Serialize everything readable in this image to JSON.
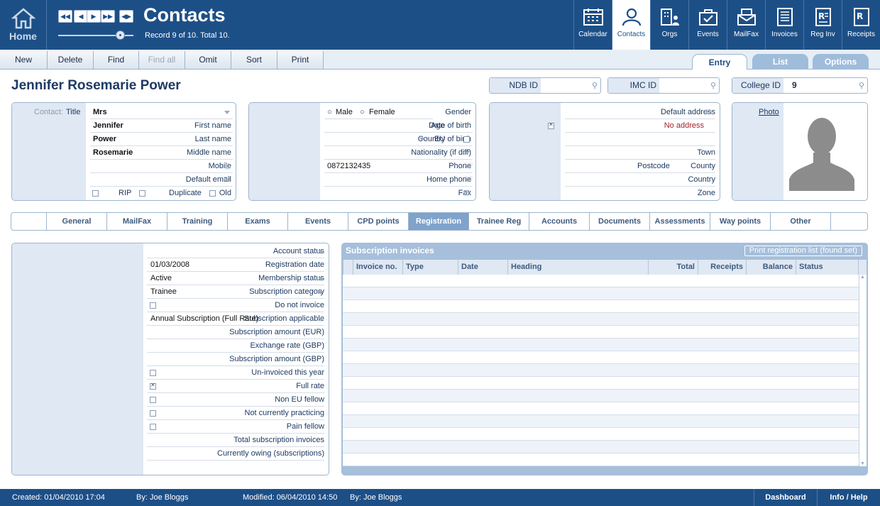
{
  "header": {
    "home_label": "Home",
    "title": "Contacts",
    "record_info": "Record 9 of 10. Total 10.",
    "modules": [
      {
        "label": "Calendar",
        "icon": "calendar-icon"
      },
      {
        "label": "Contacts",
        "icon": "person-icon"
      },
      {
        "label": "Orgs",
        "icon": "org-icon"
      },
      {
        "label": "Events",
        "icon": "events-icon"
      },
      {
        "label": "MailFax",
        "icon": "mail-icon"
      },
      {
        "label": "Invoices",
        "icon": "invoice-icon"
      },
      {
        "label": "Reg Inv",
        "icon": "reginv-icon"
      },
      {
        "label": "Receipts",
        "icon": "receipt-icon"
      }
    ]
  },
  "toolbar": {
    "buttons": [
      "New",
      "Delete",
      "Find",
      "Find all",
      "Omit",
      "Sort",
      "Print"
    ]
  },
  "view_tabs": [
    "Entry",
    "List",
    "Options"
  ],
  "person": {
    "full_name": "Jennifer Rosemarie Power"
  },
  "ids": {
    "ndb_label": "NDB ID",
    "ndb_value": "",
    "imc_label": "IMC ID",
    "imc_value": "",
    "college_label": "College ID",
    "college_value": "9"
  },
  "contact": {
    "contact_label": "Contact:",
    "title_label": "Title",
    "title": "Mrs",
    "first_name_label": "First name",
    "first_name": "Jennifer",
    "last_name_label": "Last name",
    "last_name": "Power",
    "middle_name_label": "Middle name",
    "middle_name": "Rosemarie",
    "mobile_label": "Mobile",
    "mobile": "",
    "email_label": "Default email",
    "email": "",
    "old_label": "Old",
    "rip_label": "RIP",
    "duplicate_label": "Duplicate"
  },
  "personal": {
    "gender_label": "Gender",
    "male": "Male",
    "female": "Female",
    "dob_label": "Date of birth",
    "age_label": "Age",
    "cob_label": "Country of birth",
    "eu_label": "EU",
    "nationality_label": "Nationality (if diff)",
    "phone_label": "Phone",
    "phone": "0872132435",
    "home_phone_label": "Home phone",
    "fax_label": "Fax"
  },
  "address": {
    "default_label": "Default address",
    "no_address_label": "No address",
    "town_label": "Town",
    "county_label": "County",
    "postcode_label": "Postcode",
    "country_label": "Country",
    "zone_label": "Zone"
  },
  "photo": {
    "label": "Photo"
  },
  "section_tabs": [
    "General",
    "MailFax",
    "Training",
    "Exams",
    "Events",
    "CPD points",
    "Registration",
    "Trainee Reg",
    "Accounts",
    "Documents",
    "Assessments",
    "Way points",
    "Other"
  ],
  "registration": {
    "fields": [
      {
        "label": "Account status",
        "value": "",
        "type": "dropdown"
      },
      {
        "label": "Registration date",
        "value": "01/03/2008",
        "type": "text"
      },
      {
        "label": "Membership status",
        "value": "Active",
        "type": "dropdown"
      },
      {
        "label": "Subscription category",
        "value": "Trainee",
        "type": "dropdown"
      },
      {
        "label": "Do not invoice",
        "value": "",
        "type": "checkbox",
        "checked": false
      },
      {
        "label": "Subscription applicable",
        "value": "Annual Subscription (Full Rate)",
        "type": "dropdown"
      },
      {
        "label": "Subscription amount (EUR)",
        "value": "",
        "type": "text"
      },
      {
        "label": "Exchange rate (GBP)",
        "value": "",
        "type": "text"
      },
      {
        "label": "Subscription amount (GBP)",
        "value": "",
        "type": "text"
      },
      {
        "label": "Un-invoiced this year",
        "value": "",
        "type": "checkbox",
        "checked": false
      },
      {
        "label": "Full rate",
        "value": "",
        "type": "checkbox",
        "checked": true
      },
      {
        "label": "Non EU fellow",
        "value": "",
        "type": "checkbox",
        "checked": false
      },
      {
        "label": "Not currently practicing",
        "value": "",
        "type": "checkbox",
        "checked": false
      },
      {
        "label": "Pain fellow",
        "value": "",
        "type": "checkbox",
        "checked": false
      },
      {
        "label": "Total subscription invoices",
        "value": "",
        "type": "text"
      },
      {
        "label": "Currently owing (subscriptions)",
        "value": "",
        "type": "text"
      }
    ]
  },
  "invoices": {
    "title": "Subscription invoices",
    "print_button": "Print registration list (found set)",
    "columns": [
      "Invoice no.",
      "Type",
      "Date",
      "Heading",
      "Total",
      "Receipts",
      "Balance",
      "Status"
    ]
  },
  "footer": {
    "created": "Created: 01/04/2010  17:04",
    "created_by": "By: Joe Bloggs",
    "modified": "Modified: 06/04/2010  14:50",
    "modified_by": "By: Joe Bloggs",
    "dashboard": "Dashboard",
    "info_help": "Info / Help"
  },
  "colors": {
    "header_bg": "#1d4f87",
    "label_bg": "#dfe8f3",
    "active_tab": "#7fa3cb"
  }
}
